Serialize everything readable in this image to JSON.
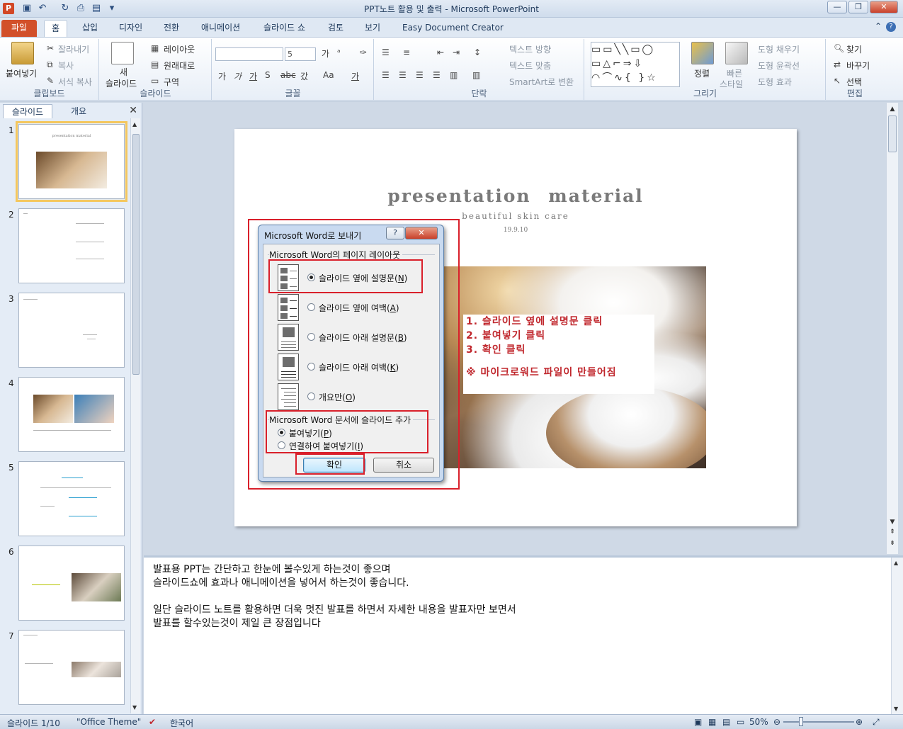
{
  "window": {
    "title": "PPT노트 활용 및 출력 - Microsoft PowerPoint",
    "app_logo": "P",
    "controls": {
      "minimize": "—",
      "restore": "❐",
      "close": "✕"
    }
  },
  "ribbon_tabs": [
    "파일",
    "홈",
    "삽입",
    "디자인",
    "전환",
    "애니메이션",
    "슬라이드 쇼",
    "검토",
    "보기",
    "Easy Document Creator"
  ],
  "ribbon": {
    "clipboard": {
      "paste": "붙여넣기",
      "cut": "잘라내기",
      "copy": "복사",
      "format_painter": "서식 복사",
      "label": "클립보드"
    },
    "slides": {
      "new_slide_1": "새",
      "new_slide_2": "슬라이드",
      "layout": "레이아웃",
      "reset": "원래대로",
      "section": "구역",
      "label": "슬라이드"
    },
    "font": {
      "font_size": "5",
      "label": "글꼴",
      "row2": [
        "가",
        "가",
        "가",
        "S",
        "abc",
        "갔",
        "Aa",
        "가"
      ]
    },
    "paragraph": {
      "text_direction": "텍스트 방향",
      "align_text": "텍스트 맞춤",
      "smartart": "SmartArt로 변환",
      "label": "단락"
    },
    "drawing": {
      "arrange": "정렬",
      "quick_styles_1": "빠른",
      "quick_styles_2": "스타일",
      "shape_fill": "도형 채우기",
      "shape_outline": "도형 윤곽선",
      "shape_effects": "도형 효과",
      "label": "그리기"
    },
    "editing": {
      "find": "찾기",
      "replace": "바꾸기",
      "select": "선택",
      "label": "편집"
    }
  },
  "left_panel": {
    "tabs": [
      "슬라이드",
      "개요"
    ],
    "thumb1_title": "presentation material",
    "thumbnails": [
      "1",
      "2",
      "3",
      "4",
      "5",
      "6",
      "7"
    ]
  },
  "slide": {
    "title": "presentation   material",
    "subtitle": "beautiful skin care",
    "date": "19.9.10",
    "callout": {
      "line1": "1. 슬라이드 옆에 설명문 클릭",
      "line2": "2. 붙여넣기 클릭",
      "line3": "3. 확인 클릭",
      "note": "※ 마이크로워드 파일이 만들어짐"
    }
  },
  "dialog": {
    "title": "Microsoft Word로 보내기",
    "help": "?",
    "close": "✕",
    "layout_group": "Microsoft Word의 페이지 레이아웃",
    "options": [
      {
        "label": "슬라이드 옆에 설명문",
        "key": "N",
        "selected": true
      },
      {
        "label": "슬라이드 옆에 여백",
        "key": "A",
        "selected": false
      },
      {
        "label": "슬라이드 아래 설명문",
        "key": "B",
        "selected": false
      },
      {
        "label": "슬라이드 아래 여백",
        "key": "K",
        "selected": false
      },
      {
        "label": "개요만",
        "key": "O",
        "selected": false
      }
    ],
    "add_group": "Microsoft Word 문서에 슬라이드 추가",
    "paste_option": {
      "label": "붙여넣기",
      "key": "P",
      "selected": true
    },
    "paste_link_option": {
      "label": "연결하여 붙여넣기",
      "key": "I",
      "selected": false
    },
    "ok": "확인",
    "cancel": "취소"
  },
  "notes": {
    "text": "발표용 PPT는 간단하고 한눈에 볼수있게 하는것이 좋으며\n슬라이드쇼에 효과나 애니메이션을 넣어서 하는것이 좋습니다.\n\n일단 슬라이드 노트를 활용하면 더욱 멋진 발표를 하면서 자세한 내용을 발표자만 보면서\n발표를 할수있는것이 제일 큰 장점입니다"
  },
  "statusbar": {
    "slide_counter": "슬라이드 1/10",
    "theme": "\"Office Theme\"",
    "language": "한국어",
    "zoom": "50%"
  },
  "colors": {
    "accent_red": "#d9202b",
    "file_tab": "#d2502a",
    "callout_text": "#c0272d"
  }
}
